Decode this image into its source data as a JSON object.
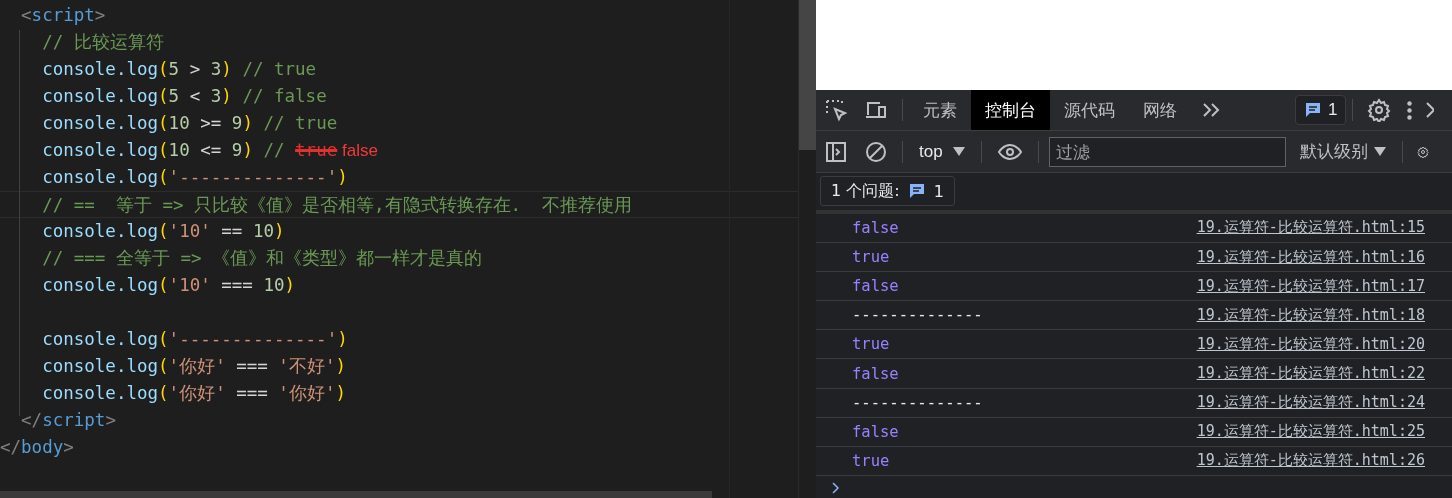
{
  "editor": {
    "lines": [
      {
        "kind": "code",
        "highlighted": false,
        "tokens": [
          {
            "kind": "punct",
            "text": "  <"
          },
          {
            "kind": "tag",
            "text": "script"
          },
          {
            "kind": "punct",
            "text": ">"
          }
        ]
      },
      {
        "kind": "code",
        "highlighted": false,
        "tokens": [
          {
            "kind": "comment",
            "text": "    // 比较运算符"
          }
        ]
      },
      {
        "kind": "code",
        "highlighted": false,
        "tokens": [
          {
            "kind": "ident",
            "text": "    console.log"
          },
          {
            "kind": "paren",
            "text": "("
          },
          {
            "kind": "num",
            "text": "5"
          },
          {
            "kind": "op",
            "text": " > "
          },
          {
            "kind": "num",
            "text": "3"
          },
          {
            "kind": "paren",
            "text": ")"
          },
          {
            "kind": "comment",
            "text": " // true"
          }
        ]
      },
      {
        "kind": "code",
        "highlighted": false,
        "tokens": [
          {
            "kind": "ident",
            "text": "    console.log"
          },
          {
            "kind": "paren",
            "text": "("
          },
          {
            "kind": "num",
            "text": "5"
          },
          {
            "kind": "op",
            "text": " < "
          },
          {
            "kind": "num",
            "text": "3"
          },
          {
            "kind": "paren",
            "text": ")"
          },
          {
            "kind": "comment",
            "text": " // false"
          }
        ]
      },
      {
        "kind": "code",
        "highlighted": false,
        "tokens": [
          {
            "kind": "ident",
            "text": "    console.log"
          },
          {
            "kind": "paren",
            "text": "("
          },
          {
            "kind": "num",
            "text": "10"
          },
          {
            "kind": "op",
            "text": " >= "
          },
          {
            "kind": "num",
            "text": "9"
          },
          {
            "kind": "paren",
            "text": ")"
          },
          {
            "kind": "comment",
            "text": " // true"
          }
        ]
      },
      {
        "kind": "code",
        "highlighted": false,
        "tokens": [
          {
            "kind": "ident",
            "text": "    console.log"
          },
          {
            "kind": "paren",
            "text": "("
          },
          {
            "kind": "num",
            "text": "10"
          },
          {
            "kind": "op",
            "text": " <= "
          },
          {
            "kind": "num",
            "text": "9"
          },
          {
            "kind": "paren",
            "text": ")"
          },
          {
            "kind": "comment",
            "text": " // "
          },
          {
            "kind": "struck",
            "text": "true"
          },
          {
            "kind": "note",
            "text": " false"
          }
        ]
      },
      {
        "kind": "code",
        "highlighted": false,
        "tokens": [
          {
            "kind": "ident",
            "text": "    console.log"
          },
          {
            "kind": "paren",
            "text": "("
          },
          {
            "kind": "string",
            "text": "'--------------'"
          },
          {
            "kind": "paren",
            "text": ")"
          }
        ]
      },
      {
        "kind": "code",
        "highlighted": true,
        "tokens": [
          {
            "kind": "comment",
            "text": "    // ==  等于 => 只比较《值》是否相等,有隐式转换存在.  不推荐使用"
          }
        ]
      },
      {
        "kind": "code",
        "highlighted": false,
        "tokens": [
          {
            "kind": "ident",
            "text": "    console.log"
          },
          {
            "kind": "paren",
            "text": "("
          },
          {
            "kind": "string",
            "text": "'10'"
          },
          {
            "kind": "op",
            "text": " == "
          },
          {
            "kind": "num",
            "text": "10"
          },
          {
            "kind": "paren",
            "text": ")"
          }
        ]
      },
      {
        "kind": "code",
        "highlighted": false,
        "tokens": [
          {
            "kind": "comment",
            "text": "    // === 全等于 => 《值》和《类型》都一样才是真的"
          }
        ]
      },
      {
        "kind": "code",
        "highlighted": false,
        "tokens": [
          {
            "kind": "ident",
            "text": "    console.log"
          },
          {
            "kind": "paren",
            "text": "("
          },
          {
            "kind": "string",
            "text": "'10'"
          },
          {
            "kind": "op",
            "text": " === "
          },
          {
            "kind": "num",
            "text": "10"
          },
          {
            "kind": "paren",
            "text": ")"
          }
        ]
      },
      {
        "kind": "blank"
      },
      {
        "kind": "code",
        "highlighted": false,
        "tokens": [
          {
            "kind": "ident",
            "text": "    console.log"
          },
          {
            "kind": "paren",
            "text": "("
          },
          {
            "kind": "string",
            "text": "'--------------'"
          },
          {
            "kind": "paren",
            "text": ")"
          }
        ]
      },
      {
        "kind": "code",
        "highlighted": false,
        "tokens": [
          {
            "kind": "ident",
            "text": "    console.log"
          },
          {
            "kind": "paren",
            "text": "("
          },
          {
            "kind": "string",
            "text": "'你好'"
          },
          {
            "kind": "op",
            "text": " === "
          },
          {
            "kind": "string",
            "text": "'不好'"
          },
          {
            "kind": "paren",
            "text": ")"
          }
        ]
      },
      {
        "kind": "code",
        "highlighted": false,
        "tokens": [
          {
            "kind": "ident",
            "text": "    console.log"
          },
          {
            "kind": "paren",
            "text": "("
          },
          {
            "kind": "string",
            "text": "'你好'"
          },
          {
            "kind": "op",
            "text": " === "
          },
          {
            "kind": "string",
            "text": "'你好'"
          },
          {
            "kind": "paren",
            "text": ")"
          }
        ]
      },
      {
        "kind": "code",
        "highlighted": false,
        "tokens": [
          {
            "kind": "punct",
            "text": "  </"
          },
          {
            "kind": "tag",
            "text": "script"
          },
          {
            "kind": "punct",
            "text": ">"
          }
        ]
      },
      {
        "kind": "code",
        "highlighted": false,
        "tokens": [
          {
            "kind": "punct",
            "text": "</"
          },
          {
            "kind": "tag",
            "text": "body"
          },
          {
            "kind": "punct",
            "text": ">"
          }
        ]
      }
    ]
  },
  "devtools": {
    "tabs": [
      {
        "label": "元素",
        "selected": false
      },
      {
        "label": "控制台",
        "selected": true
      },
      {
        "label": "源代码",
        "selected": false
      },
      {
        "label": "网络",
        "selected": false
      }
    ],
    "issues_badge": "1",
    "context": "top",
    "filter": {
      "placeholder": "过滤"
    },
    "level_select": "默认级别",
    "issues_bar": {
      "label": "1 个问题:",
      "count": "1"
    },
    "messages": [
      {
        "kind": "boolean",
        "value": "false",
        "source": "19.运算符-比较运算符.html:15"
      },
      {
        "kind": "boolean",
        "value": "true",
        "source": "19.运算符-比较运算符.html:16"
      },
      {
        "kind": "boolean",
        "value": "false",
        "source": "19.运算符-比较运算符.html:17"
      },
      {
        "kind": "string",
        "value": "--------------",
        "source": "19.运算符-比较运算符.html:18"
      },
      {
        "kind": "boolean",
        "value": "true",
        "source": "19.运算符-比较运算符.html:20"
      },
      {
        "kind": "boolean",
        "value": "false",
        "source": "19.运算符-比较运算符.html:22"
      },
      {
        "kind": "string",
        "value": "--------------",
        "source": "19.运算符-比较运算符.html:24"
      },
      {
        "kind": "boolean",
        "value": "false",
        "source": "19.运算符-比较运算符.html:25"
      },
      {
        "kind": "boolean",
        "value": "true",
        "source": "19.运算符-比较运算符.html:26"
      }
    ]
  }
}
